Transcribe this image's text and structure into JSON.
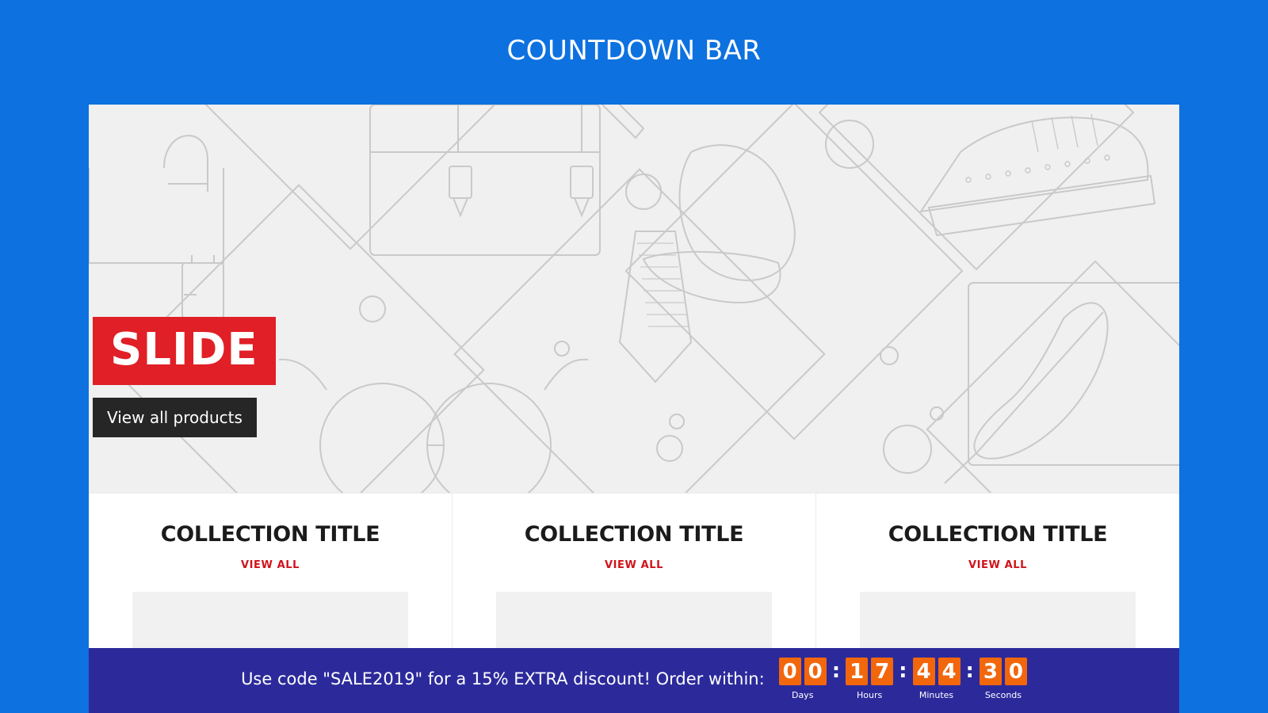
{
  "page": {
    "title": "COUNTDOWN BAR",
    "background_color": "#0d71e0"
  },
  "hero": {
    "slide_label": "SLIDE",
    "cta_label": "View all products",
    "badge_color": "#e01f26",
    "cta_color": "#262626"
  },
  "collections": [
    {
      "title": "COLLECTION TITLE",
      "view_all": "VIEW ALL"
    },
    {
      "title": "COLLECTION TITLE",
      "view_all": "VIEW ALL"
    },
    {
      "title": "COLLECTION TITLE",
      "view_all": "VIEW ALL"
    }
  ],
  "countdown": {
    "message": "Use code \"SALE2019\" for a 15% EXTRA discount! Order within:",
    "separator": ":",
    "bar_color": "#2c2a9b",
    "digit_color": "#f2660c",
    "units": [
      {
        "label": "Days",
        "d1": "0",
        "d2": "0"
      },
      {
        "label": "Hours",
        "d1": "1",
        "d2": "7"
      },
      {
        "label": "Minutes",
        "d1": "4",
        "d2": "4"
      },
      {
        "label": "Seconds",
        "d1": "3",
        "d2": "0"
      }
    ]
  }
}
